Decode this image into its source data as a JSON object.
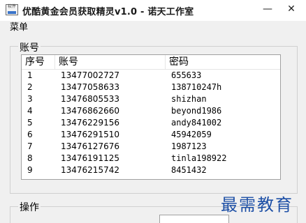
{
  "window": {
    "title": "优酷黄金会员获取精灵v1.0 - 诺天工作室",
    "app_icon_text": "软件",
    "minimize": "—",
    "close": "✕"
  },
  "menu": {
    "label": "菜单"
  },
  "accounts_group": {
    "label": "账号",
    "columns": [
      "序号",
      "账号",
      "密码"
    ],
    "rows": [
      [
        "1",
        "13477002727",
        "655633"
      ],
      [
        "2",
        "13477058633",
        "138710247h"
      ],
      [
        "3",
        "13476805533",
        "shizhan"
      ],
      [
        "4",
        "13476862660",
        "beyond1986"
      ],
      [
        "5",
        "13476229156",
        "andy841002"
      ],
      [
        "6",
        "13476291510",
        "45942059"
      ],
      [
        "7",
        "13476127676",
        "1987123"
      ],
      [
        "8",
        "13476191125",
        "tinla198922"
      ],
      [
        "9",
        "13476215742",
        "8451432"
      ]
    ]
  },
  "operations_group": {
    "label": "操作"
  },
  "watermark": "最需教育",
  "colors": {
    "watermark": "#1e50a6",
    "window_bg": "#f0f0f0"
  }
}
